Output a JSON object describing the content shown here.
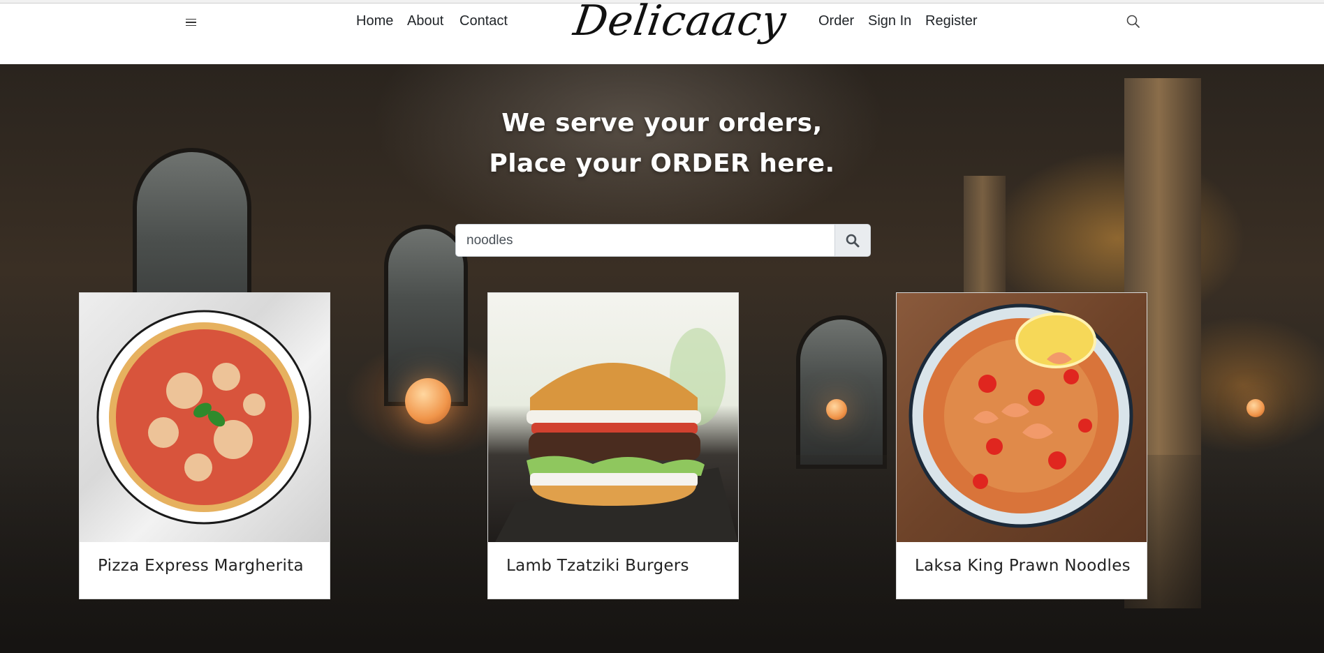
{
  "navbar": {
    "menu_icon": "hamburger-menu-icon",
    "left_links": [
      "Home",
      "About",
      "Contact"
    ],
    "logo_text": "Delicaacy",
    "right_links": [
      "Order",
      "Sign In",
      "Register"
    ],
    "search_icon": "search-icon"
  },
  "hero": {
    "title_line1": "We serve your orders,",
    "title_line2": "Place your ORDER here.",
    "search": {
      "value": "noodles",
      "button_icon": "search-icon"
    }
  },
  "cards": [
    {
      "title": "Pizza Express Margherita",
      "image": "pizza-image"
    },
    {
      "title": "Lamb Tzatziki Burgers",
      "image": "burger-image"
    },
    {
      "title": "Laksa King Prawn Noodles",
      "image": "prawn-noodles-image"
    }
  ],
  "colors": {
    "navbar_bg": "#ffffff",
    "hero_overlay": "#2a241e",
    "search_button_bg": "#e9ecef",
    "text_dark": "#212529"
  }
}
